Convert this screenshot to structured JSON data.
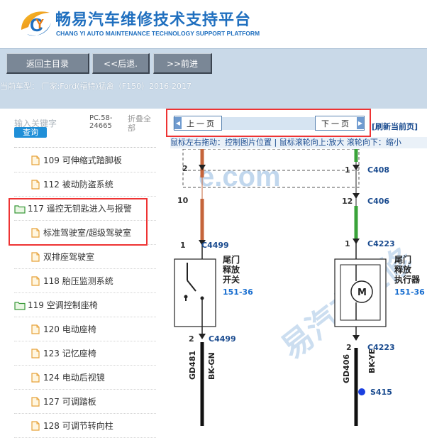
{
  "header": {
    "title": "畅易汽车维修技术支持平台",
    "subtitle": "CHANG YI AUTO MAINTENANCE TECHNOLOGY SUPPORT PLATFORM"
  },
  "toolbar": {
    "home_label": "返回主目录",
    "back_label": "<<后退.",
    "forward_label": ">>前进"
  },
  "vehicle": {
    "current": "当前车型：  厂家:Ford(福特)猛禽（F150）2016-2017"
  },
  "sidebar": {
    "search_placeholder": "输入关键字",
    "search_button": "查询",
    "pc_code": "PC.58-24665",
    "fold_all": "折叠全部",
    "items": [
      {
        "label": "109 可伸缩式踏脚板",
        "type": "file"
      },
      {
        "label": "112 被动防盗系统",
        "type": "file"
      },
      {
        "label": "117 遥控无钥匙进入与报警",
        "type": "folder"
      },
      {
        "label": "标准驾驶室/超级驾驶室",
        "type": "file"
      },
      {
        "label": "双排座驾驶室",
        "type": "file"
      },
      {
        "label": "118 胎压监测系统",
        "type": "file"
      },
      {
        "label": "119 空调控制座椅",
        "type": "folder"
      },
      {
        "label": "120 电动座椅",
        "type": "file"
      },
      {
        "label": "123 记忆座椅",
        "type": "file"
      },
      {
        "label": "124 电动后视镜",
        "type": "file"
      },
      {
        "label": "127 可调踏板",
        "type": "file"
      },
      {
        "label": "128 可调节转向柱",
        "type": "file"
      }
    ]
  },
  "viewer": {
    "prev_label": "上一页",
    "next_label": "下一页",
    "refresh_label": "[刷新当前页]",
    "hint": "鼠标左右拖动：控制图片位置 | 鼠标滚轮向上:放大  滚轮向下：缩小"
  },
  "diagram": {
    "watermark_url": "e.com",
    "watermark_brand": "易汽车维修",
    "left_circuit": {
      "pins": [
        "2",
        "10",
        "1",
        "2"
      ],
      "connectors": [
        "C4499",
        "C4499"
      ],
      "component_name": [
        "尾门",
        "释放",
        "开关"
      ],
      "page_ref": "151-36",
      "wire_codes": [
        "GD481",
        "BK-GN"
      ]
    },
    "right_circuit": {
      "pins": [
        "1",
        "12",
        "1",
        "2"
      ],
      "connectors": [
        "C408",
        "C406",
        "C4223",
        "C4223"
      ],
      "component_name": [
        "尾门",
        "释放",
        "执行器"
      ],
      "page_ref": "151-36",
      "motor_label": "M",
      "wire_codes": [
        "GD406",
        "BK-YE"
      ],
      "splice": "S415"
    }
  },
  "colors": {
    "brand_blue": "#1f6fbf",
    "toolbar_bg": "#c9d9e8",
    "button_gray": "#7a8796",
    "highlight_red": "#e33333",
    "search_blue": "#1f8fd8",
    "wire_orange": "#c5643a",
    "wire_green": "#3aa33a"
  }
}
